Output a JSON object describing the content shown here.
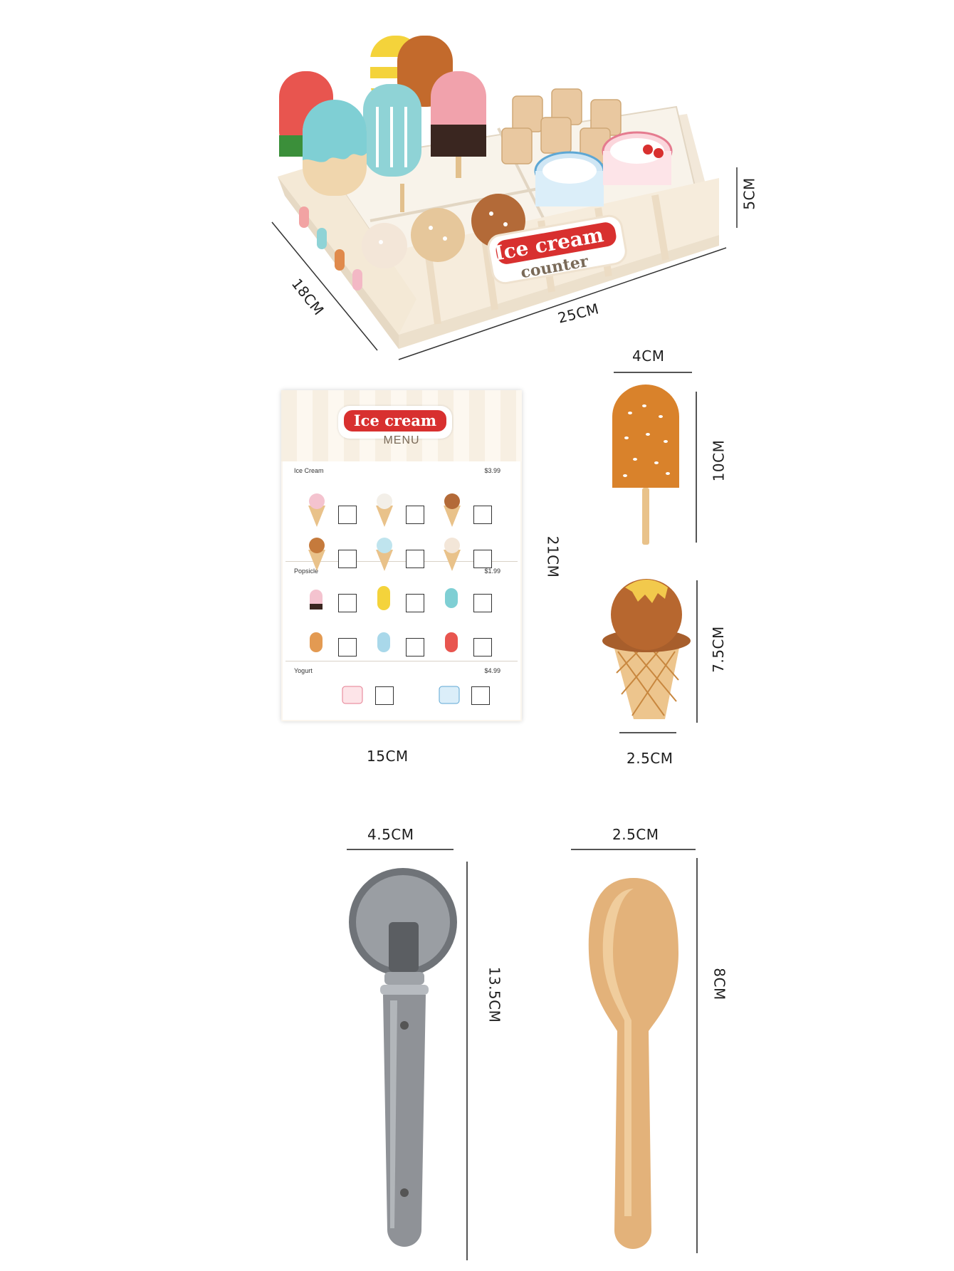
{
  "box": {
    "sign_line1": "Ice cream",
    "sign_line2": "counter",
    "dims": {
      "depth": "18CM",
      "width": "25CM",
      "height": "5CM"
    }
  },
  "menu": {
    "title": "Ice cream",
    "subtitle": "MENU",
    "sections": [
      {
        "name": "Ice Cream",
        "price": "$3.99"
      },
      {
        "name": "Popsicle",
        "price": "$1.99"
      },
      {
        "name": "Yogurt",
        "price": "$4.99"
      }
    ],
    "dims": {
      "width": "15CM",
      "height": "21CM"
    }
  },
  "popsicle": {
    "dims": {
      "width": "4CM",
      "height": "10CM"
    }
  },
  "cone": {
    "dims": {
      "width": "2.5CM",
      "height": "7.5CM"
    }
  },
  "scoop": {
    "dims": {
      "width": "4.5CM",
      "height": "13.5CM"
    }
  },
  "spoon": {
    "dims": {
      "width": "2.5CM",
      "height": "8CM"
    }
  },
  "colors": {
    "sign_red": "#d8302f",
    "wood": "#e9c28a",
    "popsicle_orange": "#d9822b",
    "scoop_grey": "#8f9297"
  }
}
